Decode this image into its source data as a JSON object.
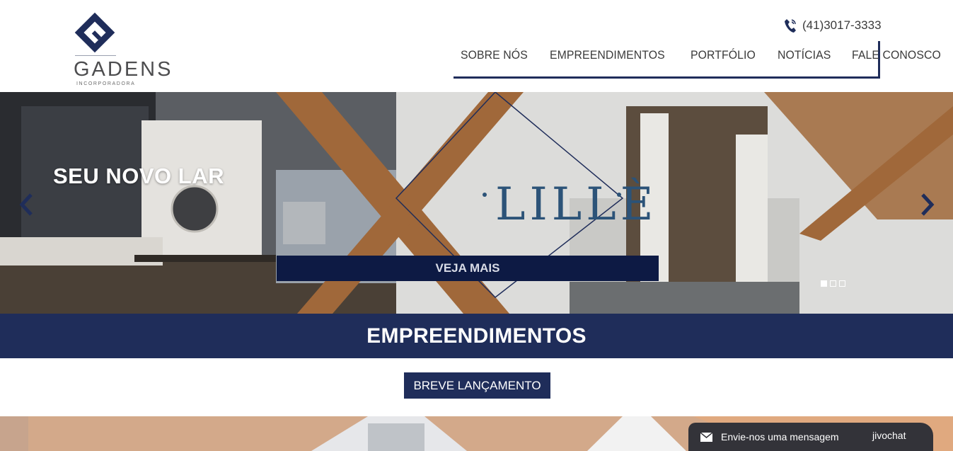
{
  "header": {
    "logo_name": "GADENS",
    "logo_sub": "INCORPORADORA",
    "phone": "(41)3017-3333"
  },
  "nav": {
    "items": [
      {
        "label": "SOBRE NÓS"
      },
      {
        "label": "EMPREENDIMENTOS"
      },
      {
        "label": "PORTFÓLIO"
      },
      {
        "label": "NOTÍCIAS"
      },
      {
        "label": "FALE CONOSCO"
      }
    ]
  },
  "hero": {
    "title": "SEU NOVO LAR",
    "brand_word": "LILLÈ",
    "button_label": "VEJA MAIS",
    "slides_total": 3,
    "active_slide": 1
  },
  "section": {
    "title": "EMPREENDIMENTOS",
    "filter_label": "BREVE LANÇAMENTO"
  },
  "chat": {
    "message": "Envie-nos uma mensagem",
    "brand": "jivochat"
  },
  "colors": {
    "brand_navy": "#1f2d5a",
    "button_dark": "#0d1a44",
    "copper": "#a0683a",
    "chat_bg": "#333339"
  }
}
